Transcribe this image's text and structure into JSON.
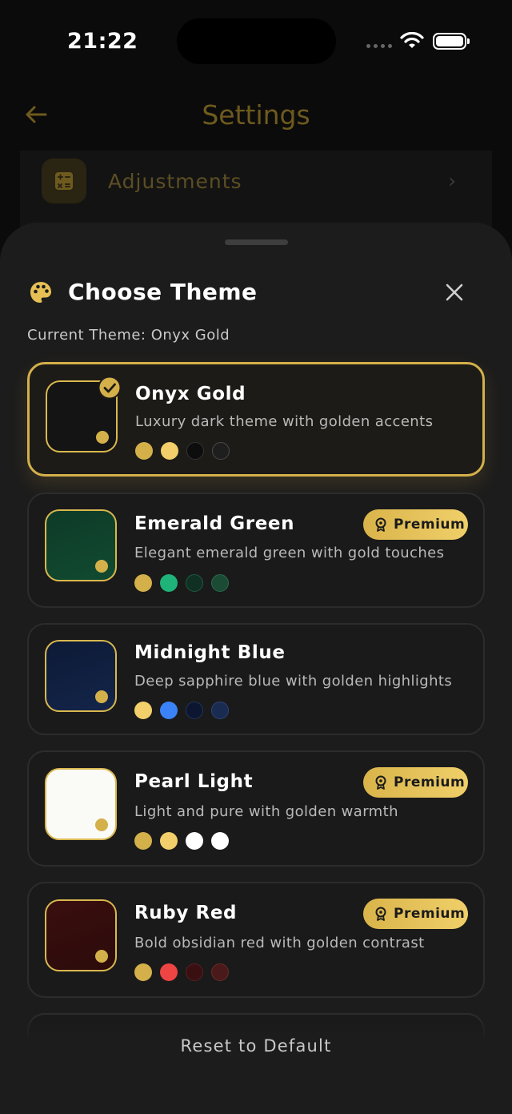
{
  "status_bar": {
    "time": "21:22"
  },
  "header": {
    "title": "Settings",
    "back_icon": "arrow-left-icon"
  },
  "behind_list": {
    "item_label": "Adjustments",
    "item_icon": "calculator-icon"
  },
  "sheet": {
    "title": "Choose Theme",
    "title_icon": "palette-icon",
    "close_icon": "close-icon",
    "current_theme_label": "Current Theme: Onyx Gold",
    "reset_label": "Reset to Default",
    "premium_label": "Premium"
  },
  "themes": [
    {
      "name": "Onyx Gold",
      "description": "Luxury dark theme with golden accents",
      "selected": true,
      "premium": false,
      "swatch_bg": "#141414",
      "colors": [
        "#d4b04a",
        "#f2cf6b",
        "#0d0d0d",
        "#262626"
      ]
    },
    {
      "name": "Emerald Green",
      "description": "Elegant emerald green with gold touches",
      "selected": false,
      "premium": true,
      "swatch_bg": "#0d3a26",
      "colors": [
        "#d4b04a",
        "#1fb37a",
        "#0f3023",
        "#1b4a35"
      ]
    },
    {
      "name": "Midnight Blue",
      "description": "Deep sapphire blue with golden highlights",
      "selected": false,
      "premium": false,
      "swatch_bg": "#0f1d3d",
      "colors": [
        "#f2cf6b",
        "#3b82f6",
        "#0c1630",
        "#1a2b52"
      ]
    },
    {
      "name": "Pearl Light",
      "description": "Light and pure with golden warmth",
      "selected": false,
      "premium": true,
      "swatch_bg": "#fafaf7",
      "colors": [
        "#d4b04a",
        "#f2cf6b",
        "#ffffff",
        "#ffffff"
      ]
    },
    {
      "name": "Ruby Red",
      "description": "Bold obsidian red with golden contrast",
      "selected": false,
      "premium": true,
      "swatch_bg": "#3a0f0f",
      "colors": [
        "#d4b04a",
        "#ef4444",
        "#3a0f12",
        "#4a1a1a"
      ]
    }
  ]
}
